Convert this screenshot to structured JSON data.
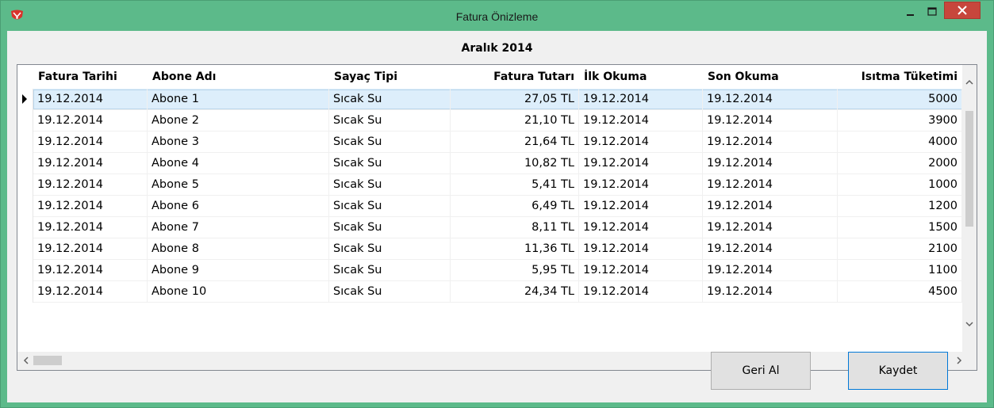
{
  "window": {
    "title": "Fatura Önizleme",
    "accent_color": "#5cba8a",
    "close_color": "#c7463c",
    "controls": [
      "minimize-icon",
      "maximize-icon",
      "close-icon"
    ]
  },
  "main": {
    "period_label": "Aralık 2014"
  },
  "grid": {
    "columns": [
      "Fatura Tarihi",
      "Abone Adı",
      "Sayaç Tipi",
      "Fatura Tutarı",
      "İlk Okuma",
      "Son Okuma",
      "Isıtma Tüketimi"
    ],
    "selected_row": 0,
    "rows": [
      [
        "19.12.2014",
        "Abone 1",
        "Sıcak Su",
        "27,05 TL",
        "19.12.2014",
        "19.12.2014",
        "5000"
      ],
      [
        "19.12.2014",
        "Abone 2",
        "Sıcak Su",
        "21,10 TL",
        "19.12.2014",
        "19.12.2014",
        "3900"
      ],
      [
        "19.12.2014",
        "Abone 3",
        "Sıcak Su",
        "21,64 TL",
        "19.12.2014",
        "19.12.2014",
        "4000"
      ],
      [
        "19.12.2014",
        "Abone 4",
        "Sıcak Su",
        "10,82 TL",
        "19.12.2014",
        "19.12.2014",
        "2000"
      ],
      [
        "19.12.2014",
        "Abone 5",
        "Sıcak Su",
        "5,41 TL",
        "19.12.2014",
        "19.12.2014",
        "1000"
      ],
      [
        "19.12.2014",
        "Abone 6",
        "Sıcak Su",
        "6,49 TL",
        "19.12.2014",
        "19.12.2014",
        "1200"
      ],
      [
        "19.12.2014",
        "Abone 7",
        "Sıcak Su",
        "8,11 TL",
        "19.12.2014",
        "19.12.2014",
        "1500"
      ],
      [
        "19.12.2014",
        "Abone 8",
        "Sıcak Su",
        "11,36 TL",
        "19.12.2014",
        "19.12.2014",
        "2100"
      ],
      [
        "19.12.2014",
        "Abone 9",
        "Sıcak Su",
        "5,95 TL",
        "19.12.2014",
        "19.12.2014",
        "1100"
      ],
      [
        "19.12.2014",
        "Abone 10",
        "Sıcak Su",
        "24,34 TL",
        "19.12.2014",
        "19.12.2014",
        "4500"
      ]
    ]
  },
  "buttons": {
    "back_label": "Geri Al",
    "save_label": "Kaydet"
  }
}
